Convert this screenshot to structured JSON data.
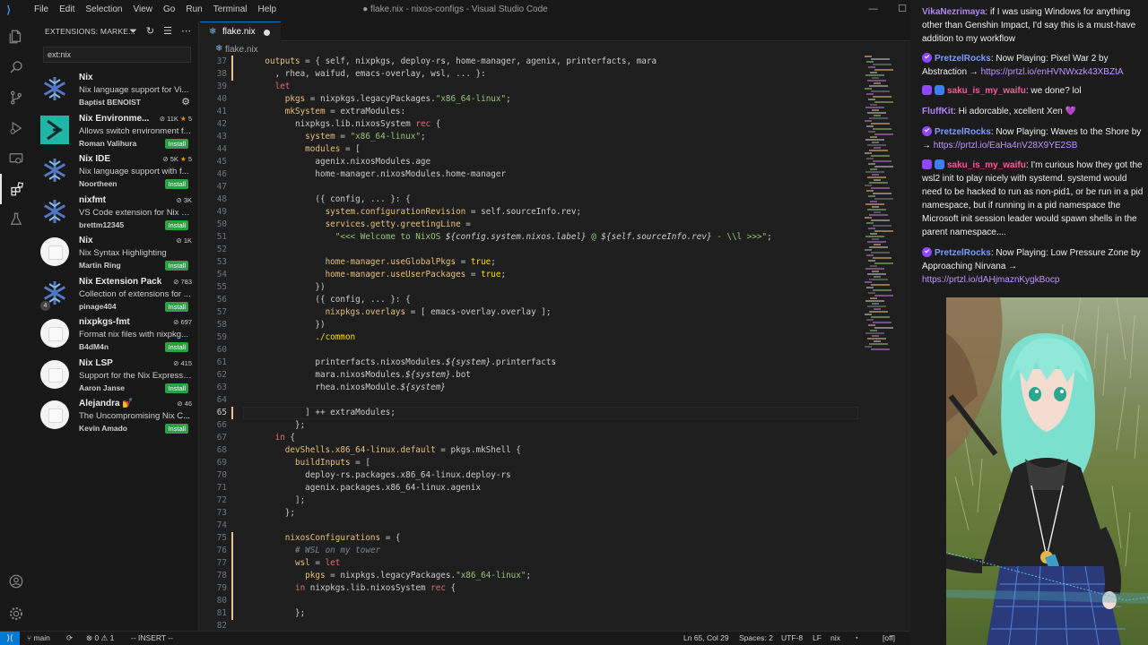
{
  "titlebar": {
    "menus": [
      "File",
      "Edit",
      "Selection",
      "View",
      "Go",
      "Run",
      "Terminal",
      "Help"
    ],
    "title": "● flake.nix - nixos-configs - Visual Studio Code"
  },
  "activity_bar": [
    "explorer",
    "search",
    "source-control",
    "run-debug",
    "remote-explorer",
    "extensions",
    "testing",
    "accounts",
    "manage"
  ],
  "sidebar": {
    "header": "EXTENSIONS: MARKE...",
    "search_value": "ext:nix",
    "extensions": [
      {
        "name": "Nix",
        "description": "Nix language support for Vi...",
        "publisher": "Baptist BENOIST",
        "downloads": "",
        "rating": "",
        "action": "gear",
        "icon": "nix-snowflake"
      },
      {
        "name": "Nix Environme...",
        "description": "Allows switch environment f...",
        "publisher": "Roman Valihura",
        "downloads": "11K",
        "rating": "5",
        "action": "Install",
        "icon": "teal-arrow"
      },
      {
        "name": "Nix IDE",
        "description": "Nix language support with f...",
        "publisher": "Noortheen",
        "downloads": "5K",
        "rating": "5",
        "action": "Install",
        "icon": "nix-snowflake"
      },
      {
        "name": "nixfmt",
        "description": "VS Code extension for Nix c...",
        "publisher": "brettm12345",
        "downloads": "3K",
        "rating": "",
        "action": "Install",
        "icon": "nix-snowflake"
      },
      {
        "name": "Nix",
        "description": "Nix Syntax Highlighting",
        "publisher": "Martin Ring",
        "downloads": "1K",
        "rating": "",
        "action": "Install",
        "icon": "default"
      },
      {
        "name": "Nix Extension Pack",
        "description": "Collection of extensions for ...",
        "publisher": "pinage404",
        "downloads": "783",
        "rating": "",
        "action": "Install",
        "icon": "nix-snowflake",
        "pack_count": "4"
      },
      {
        "name": "nixpkgs-fmt",
        "description": "Format nix files with nixpkg...",
        "publisher": "B4dM4n",
        "downloads": "697",
        "rating": "",
        "action": "Install",
        "icon": "default"
      },
      {
        "name": "Nix LSP",
        "description": "Support for the Nix Expressi...",
        "publisher": "Aaron Janse",
        "downloads": "415",
        "rating": "",
        "action": "Install",
        "icon": "default"
      },
      {
        "name": "Alejandra 💅",
        "description": "The Uncompromising Nix C...",
        "publisher": "Kevin Amado",
        "downloads": "46",
        "rating": "",
        "action": "Install",
        "icon": "default"
      }
    ]
  },
  "editor": {
    "tab": {
      "label": "flake.nix",
      "modified": true
    },
    "breadcrumb": "flake.nix",
    "current_line": 65,
    "lines": [
      {
        "n": 37,
        "tokens": [
          [
            "    ",
            "t"
          ],
          [
            "outputs",
            "f"
          ],
          [
            " = { ",
            "t"
          ],
          [
            "self",
            "t"
          ],
          [
            ", ",
            "t"
          ],
          [
            "nixpkgs",
            "t"
          ],
          [
            ", ",
            "t"
          ],
          [
            "deploy-rs",
            "t"
          ],
          [
            ", ",
            "t"
          ],
          [
            "home-manager",
            "t"
          ],
          [
            ", ",
            "t"
          ],
          [
            "agenix",
            "t"
          ],
          [
            ", ",
            "t"
          ],
          [
            "printerfacts",
            "t"
          ],
          [
            ", ",
            "t"
          ],
          [
            "mara",
            "t"
          ]
        ]
      },
      {
        "n": 38,
        "tokens": [
          [
            "      , ",
            "t"
          ],
          [
            "rhea",
            "t"
          ],
          [
            ", ",
            "t"
          ],
          [
            "waifud",
            "t"
          ],
          [
            ", ",
            "t"
          ],
          [
            "emacs-overlay",
            "t"
          ],
          [
            ", ",
            "t"
          ],
          [
            "wsl",
            "t"
          ],
          [
            ", ... }:",
            "t"
          ]
        ]
      },
      {
        "n": 39,
        "tokens": [
          [
            "      ",
            "t"
          ],
          [
            "let",
            "kw"
          ]
        ]
      },
      {
        "n": 40,
        "tokens": [
          [
            "        ",
            "t"
          ],
          [
            "pkgs",
            "f"
          ],
          [
            " = ",
            "t"
          ],
          [
            "nixpkgs",
            "t"
          ],
          [
            ".legacyPackages.",
            "t"
          ],
          [
            "\"x86_64-linux\"",
            "s"
          ],
          [
            ";",
            "t"
          ]
        ]
      },
      {
        "n": 41,
        "tokens": [
          [
            "        ",
            "t"
          ],
          [
            "mkSystem",
            "f"
          ],
          [
            " = ",
            "t"
          ],
          [
            "extraModules",
            "t"
          ],
          [
            ":",
            "t"
          ]
        ]
      },
      {
        "n": 42,
        "tokens": [
          [
            "          ",
            "t"
          ],
          [
            "nixpkgs.lib.nixosSystem",
            "t"
          ],
          [
            " ",
            "t"
          ],
          [
            "rec",
            "kw"
          ],
          [
            " {",
            "t"
          ]
        ]
      },
      {
        "n": 43,
        "tokens": [
          [
            "            ",
            "t"
          ],
          [
            "system",
            "f"
          ],
          [
            " = ",
            "t"
          ],
          [
            "\"x86_64-linux\"",
            "s"
          ],
          [
            ";",
            "t"
          ]
        ]
      },
      {
        "n": 44,
        "tokens": [
          [
            "            ",
            "t"
          ],
          [
            "modules",
            "f"
          ],
          [
            " = [",
            "t"
          ]
        ]
      },
      {
        "n": 45,
        "tokens": [
          [
            "              ",
            "t"
          ],
          [
            "agenix.nixosModules.age",
            "t"
          ]
        ]
      },
      {
        "n": 46,
        "tokens": [
          [
            "              ",
            "t"
          ],
          [
            "home-manager.nixosModules.home-manager",
            "t"
          ]
        ]
      },
      {
        "n": 47,
        "tokens": []
      },
      {
        "n": 48,
        "tokens": [
          [
            "              ({ ",
            "t"
          ],
          [
            "config",
            "t"
          ],
          [
            ", ... }: {",
            "t"
          ]
        ]
      },
      {
        "n": 49,
        "tokens": [
          [
            "                ",
            "t"
          ],
          [
            "system.configurationRevision",
            "f"
          ],
          [
            " = ",
            "t"
          ],
          [
            "self.sourceInfo.rev",
            "t"
          ],
          [
            ";",
            "t"
          ]
        ]
      },
      {
        "n": 50,
        "tokens": [
          [
            "                ",
            "t"
          ],
          [
            "services.getty.greetingLine",
            "f"
          ],
          [
            " =",
            "t"
          ]
        ]
      },
      {
        "n": 51,
        "tokens": [
          [
            "                  ",
            "t"
          ],
          [
            "\"<<< Welcome to NixOS ",
            "s"
          ],
          [
            "${config.system.nixos.label}",
            "it"
          ],
          [
            " @ ",
            "s"
          ],
          [
            "${self.sourceInfo.rev}",
            "it"
          ],
          [
            " - \\\\l >>>\"",
            "s"
          ],
          [
            ";",
            "t"
          ]
        ]
      },
      {
        "n": 52,
        "tokens": []
      },
      {
        "n": 53,
        "tokens": [
          [
            "                ",
            "t"
          ],
          [
            "home-manager.useGlobalPkgs",
            "f"
          ],
          [
            " = ",
            "t"
          ],
          [
            "true",
            "p"
          ],
          [
            ";",
            "t"
          ]
        ]
      },
      {
        "n": 54,
        "tokens": [
          [
            "                ",
            "t"
          ],
          [
            "home-manager.useUserPackages",
            "f"
          ],
          [
            " = ",
            "t"
          ],
          [
            "true",
            "p"
          ],
          [
            ";",
            "t"
          ]
        ]
      },
      {
        "n": 55,
        "tokens": [
          [
            "              })",
            "t"
          ]
        ]
      },
      {
        "n": 56,
        "tokens": [
          [
            "              ({ ",
            "t"
          ],
          [
            "config",
            "t"
          ],
          [
            ", ... }: {",
            "t"
          ]
        ]
      },
      {
        "n": 57,
        "tokens": [
          [
            "                ",
            "t"
          ],
          [
            "nixpkgs.overlays",
            "f"
          ],
          [
            " = [ ",
            "t"
          ],
          [
            "emacs-overlay.overlay",
            "t"
          ],
          [
            " ];",
            "t"
          ]
        ]
      },
      {
        "n": 58,
        "tokens": [
          [
            "              })",
            "t"
          ]
        ]
      },
      {
        "n": 59,
        "tokens": [
          [
            "              ",
            "t"
          ],
          [
            "./common",
            "p"
          ]
        ]
      },
      {
        "n": 60,
        "tokens": []
      },
      {
        "n": 61,
        "tokens": [
          [
            "              ",
            "t"
          ],
          [
            "printerfacts.nixosModules.",
            "t"
          ],
          [
            "${system}",
            "it"
          ],
          [
            ".printerfacts",
            "t"
          ]
        ]
      },
      {
        "n": 62,
        "tokens": [
          [
            "              ",
            "t"
          ],
          [
            "mara.nixosModules.",
            "t"
          ],
          [
            "${system}",
            "it"
          ],
          [
            ".bot",
            "t"
          ]
        ]
      },
      {
        "n": 63,
        "tokens": [
          [
            "              ",
            "t"
          ],
          [
            "rhea.nixosModule.",
            "t"
          ],
          [
            "${system}",
            "it"
          ]
        ]
      },
      {
        "n": 64,
        "tokens": []
      },
      {
        "n": 65,
        "tokens": [
          [
            "            ] ++ ",
            "t"
          ],
          [
            "extraModules",
            "t"
          ],
          [
            ";",
            "t"
          ]
        ]
      },
      {
        "n": 66,
        "tokens": [
          [
            "          };",
            "t"
          ]
        ]
      },
      {
        "n": 67,
        "tokens": [
          [
            "      ",
            "t"
          ],
          [
            "in",
            "kw"
          ],
          [
            " {",
            "t"
          ]
        ]
      },
      {
        "n": 68,
        "tokens": [
          [
            "        ",
            "t"
          ],
          [
            "devShells.x86_64-linux.default",
            "f"
          ],
          [
            " = ",
            "t"
          ],
          [
            "pkgs.mkShell",
            "t"
          ],
          [
            " {",
            "t"
          ]
        ]
      },
      {
        "n": 69,
        "tokens": [
          [
            "          ",
            "t"
          ],
          [
            "buildInputs",
            "f"
          ],
          [
            " = [",
            "t"
          ]
        ]
      },
      {
        "n": 70,
        "tokens": [
          [
            "            ",
            "t"
          ],
          [
            "deploy-rs.packages.x86_64-linux.deploy-rs",
            "t"
          ]
        ]
      },
      {
        "n": 71,
        "tokens": [
          [
            "            ",
            "t"
          ],
          [
            "agenix.packages.x86_64-linux.agenix",
            "t"
          ]
        ]
      },
      {
        "n": 72,
        "tokens": [
          [
            "          ];",
            "t"
          ]
        ]
      },
      {
        "n": 73,
        "tokens": [
          [
            "        };",
            "t"
          ]
        ]
      },
      {
        "n": 74,
        "tokens": []
      },
      {
        "n": 75,
        "tokens": [
          [
            "        ",
            "t"
          ],
          [
            "nixosConfigurations",
            "f"
          ],
          [
            " = {",
            "t"
          ]
        ]
      },
      {
        "n": 76,
        "tokens": [
          [
            "          ",
            "t"
          ],
          [
            "# WSL on my tower",
            "c"
          ]
        ]
      },
      {
        "n": 77,
        "tokens": [
          [
            "          ",
            "t"
          ],
          [
            "wsl",
            "f"
          ],
          [
            " = ",
            "t"
          ],
          [
            "let",
            "kw"
          ]
        ]
      },
      {
        "n": 78,
        "tokens": [
          [
            "            ",
            "t"
          ],
          [
            "pkgs",
            "f"
          ],
          [
            " = ",
            "t"
          ],
          [
            "nixpkgs.legacyPackages.",
            "t"
          ],
          [
            "\"x86_64-linux\"",
            "s"
          ],
          [
            ";",
            "t"
          ]
        ]
      },
      {
        "n": 79,
        "tokens": [
          [
            "          ",
            "t"
          ],
          [
            "in",
            "kw"
          ],
          [
            " ",
            "t"
          ],
          [
            "nixpkgs.lib.nixosSystem",
            "t"
          ],
          [
            " ",
            "t"
          ],
          [
            "rec",
            "kw"
          ],
          [
            " {",
            "t"
          ]
        ]
      },
      {
        "n": 80,
        "tokens": []
      },
      {
        "n": 81,
        "tokens": [
          [
            "          };",
            "t"
          ]
        ]
      },
      {
        "n": 82,
        "tokens": []
      }
    ]
  },
  "statusbar": {
    "branch": "main",
    "errors": "0",
    "warnings": "1",
    "mode": "-- INSERT --",
    "position": "Ln 65, Col 29",
    "spaces": "Spaces: 2",
    "encoding": "UTF-8",
    "eol": "LF",
    "language": "nix",
    "vim_state": "[off]"
  },
  "chat": [
    {
      "user": "VikaNezrimaya",
      "user_color": "#b084f5",
      "badges": [],
      "text": "if I was using Windows for anything other than Genshin Impact, I'd say this is a must-have addition to my workflow",
      "link": ""
    },
    {
      "user": "PretzelRocks",
      "user_color": "#7b9cff",
      "badges": [
        "verified"
      ],
      "text": "Now Playing: Pixel War 2 by Abstraction →",
      "link": "https://prtzl.io/enHVNWxzk43XBZtA"
    },
    {
      "user": "saku_is_my_waifu",
      "user_color": "#ff5599",
      "badges": [
        "broadcaster",
        "subscriber"
      ],
      "text": "we done? lol",
      "link": ""
    },
    {
      "user": "FluffKit",
      "user_color": "#b084f5",
      "badges": [],
      "text": "Hi adorcable, xcellent Xen",
      "link": "",
      "emote": "purple-heart"
    },
    {
      "user": "PretzelRocks",
      "user_color": "#7b9cff",
      "badges": [
        "verified"
      ],
      "text": "Now Playing: Waves to the Shore by →",
      "link": "https://prtzl.io/EaHa4nV28X9YE2SB"
    },
    {
      "user": "saku_is_my_waifu",
      "user_color": "#ff5599",
      "badges": [
        "broadcaster",
        "subscriber"
      ],
      "text": "I'm curious how they got the wsl2 init to play nicely with systemd. systemd would need to be hacked to run as non-pid1, or be run in a pid namespace, but if running in a pid namespace the Microsoft init session leader would spawn shells in the parent namespace....",
      "link": ""
    },
    {
      "user": "PretzelRocks",
      "user_color": "#7b9cff",
      "badges": [
        "verified"
      ],
      "text": "Now Playing: Low Pressure Zone by Approaching Nirvana →",
      "link": "https://prtzl.io/dAHjmaznKygkBocp"
    }
  ]
}
